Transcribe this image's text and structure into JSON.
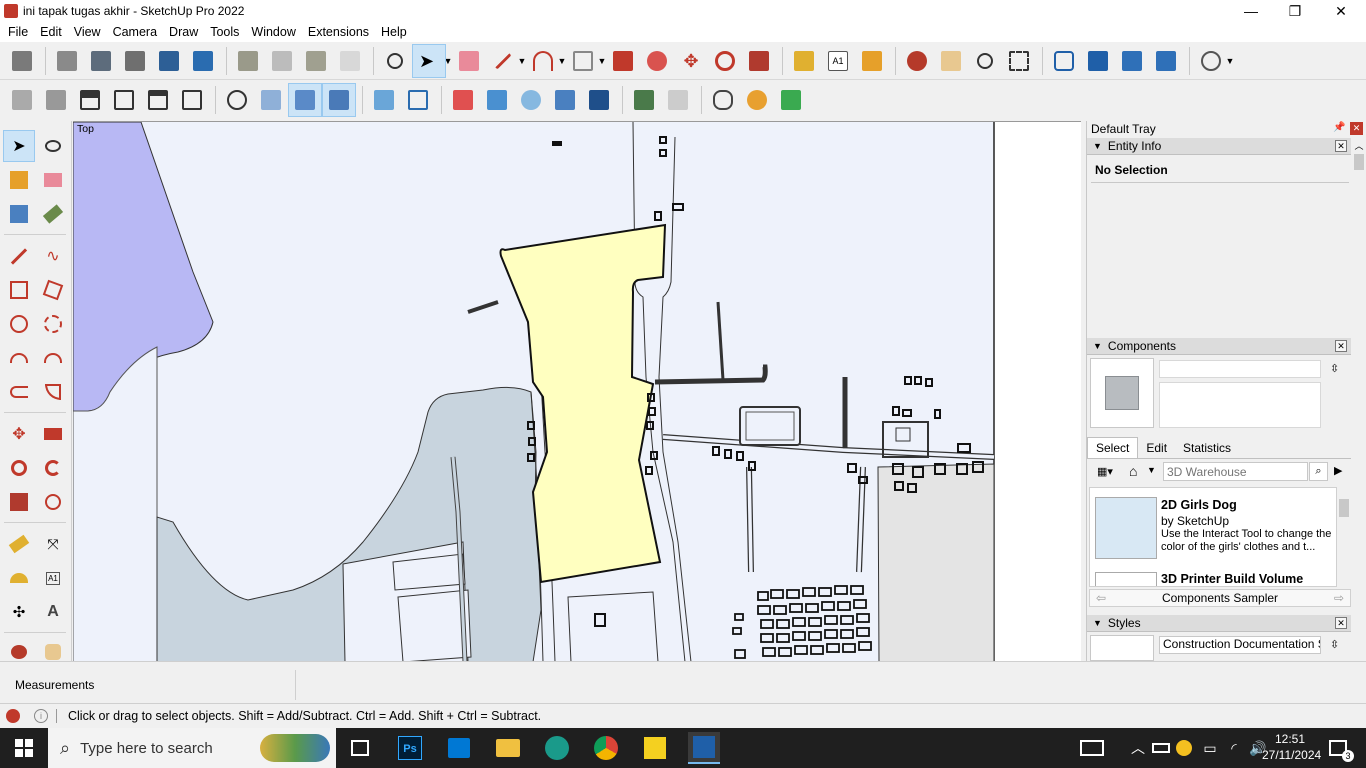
{
  "window": {
    "title": "ini tapak tugas akhir - SketchUp Pro 2022",
    "min_glyph": "—",
    "max_glyph": "❐",
    "close_glyph": "✕"
  },
  "menu": [
    "File",
    "Edit",
    "View",
    "Camera",
    "Draw",
    "Tools",
    "Window",
    "Extensions",
    "Help"
  ],
  "viewport": {
    "view_label": "Top"
  },
  "tray": {
    "title": "Default Tray",
    "entity_info": {
      "title": "Entity Info",
      "selection": "No Selection"
    },
    "components": {
      "title": "Components",
      "tabs": [
        "Select",
        "Edit",
        "Statistics"
      ],
      "search_placeholder": "3D Warehouse",
      "items": [
        {
          "name": "2D Girls Dog",
          "by": "by SketchUp",
          "desc": "Use the Interact Tool to change the color of the girls' clothes and t..."
        },
        {
          "name": "3D Printer Build Volume",
          "by": "",
          "desc": ""
        }
      ],
      "sampler": "Components Sampler"
    },
    "styles": {
      "title": "Styles",
      "style_name": "Construction Documentation Sty"
    }
  },
  "measurements": {
    "label": "Measurements"
  },
  "status": {
    "hint": "Click or drag to select objects. Shift = Add/Subtract. Ctrl = Add. Shift + Ctrl = Subtract."
  },
  "taskbar": {
    "search_placeholder": "Type here to search",
    "time": "12:51",
    "date": "27/11/2024",
    "notifications": "3"
  },
  "colors": {
    "site_fill": "#ffffc0",
    "water_fill": "#b8b8f4",
    "ground_fill": "#c8d4de",
    "sky": "#eef2fb",
    "selection": "#cce4f7"
  }
}
